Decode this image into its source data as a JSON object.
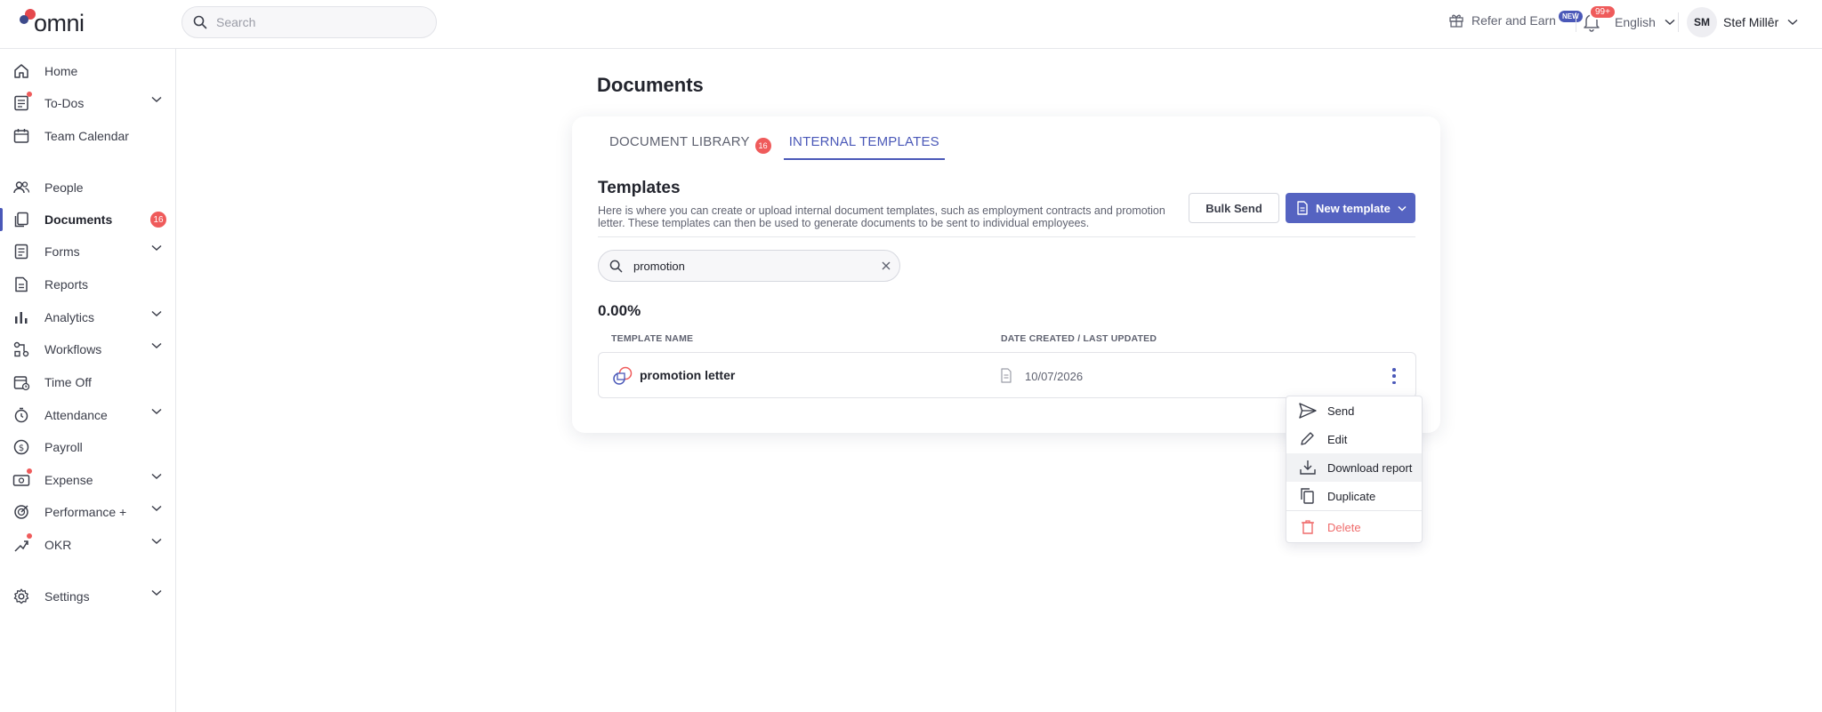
{
  "app": {
    "logo_text": "omni"
  },
  "topbar": {
    "search_placeholder": "Search",
    "refer_label": "Refer and Earn",
    "refer_badge": "NEW",
    "notif_count": "99+",
    "language": "English",
    "user_initials": "SM",
    "user_name": "Stef Millêr"
  },
  "sidebar": {
    "items": [
      {
        "label": "Home",
        "icon": "home-icon"
      },
      {
        "label": "To-Dos",
        "icon": "todo-icon"
      },
      {
        "label": "Team Calendar",
        "icon": "calendar-icon"
      },
      {
        "label": "People",
        "icon": "people-icon"
      },
      {
        "label": "Documents",
        "icon": "documents-icon",
        "count": "16"
      },
      {
        "label": "Forms",
        "icon": "forms-icon"
      },
      {
        "label": "Reports",
        "icon": "reports-icon"
      },
      {
        "label": "Analytics",
        "icon": "analytics-icon"
      },
      {
        "label": "Workflows",
        "icon": "workflows-icon"
      },
      {
        "label": "Time Off",
        "icon": "timeoff-icon"
      },
      {
        "label": "Attendance",
        "icon": "stopwatch-icon"
      },
      {
        "label": "Payroll",
        "icon": "dollar-icon"
      },
      {
        "label": "Expense",
        "icon": "expense-icon"
      },
      {
        "label": "Performance +",
        "icon": "performance-icon"
      },
      {
        "label": "OKR",
        "icon": "okr-icon"
      },
      {
        "label": "Settings",
        "icon": "gear-icon"
      }
    ]
  },
  "main": {
    "page_title": "Documents",
    "tabs": [
      {
        "label": "DOCUMENT LIBRARY",
        "badge": "16"
      },
      {
        "label": "INTERNAL TEMPLATES"
      }
    ],
    "section_title": "Templates",
    "section_desc": "Here is where you can create or upload internal document templates, such as employment contracts and promotion letter. These templates can then be used to generate documents to be sent to individual employees.",
    "bulk_send_label": "Bulk Send",
    "new_template_label": "New template",
    "filter_value": "promotion",
    "percentage": "0.00%",
    "columns": {
      "name": "TEMPLATE NAME",
      "date": "DATE CREATED / LAST UPDATED"
    },
    "rows": [
      {
        "name": "promotion letter",
        "date": "10/07/2026"
      }
    ],
    "menu": [
      {
        "label": "Send"
      },
      {
        "label": "Edit"
      },
      {
        "label": "Download report"
      },
      {
        "label": "Duplicate"
      },
      {
        "label": "Delete"
      }
    ]
  },
  "colors": {
    "accent": "#4a58b8",
    "danger": "#ef5b5b"
  }
}
